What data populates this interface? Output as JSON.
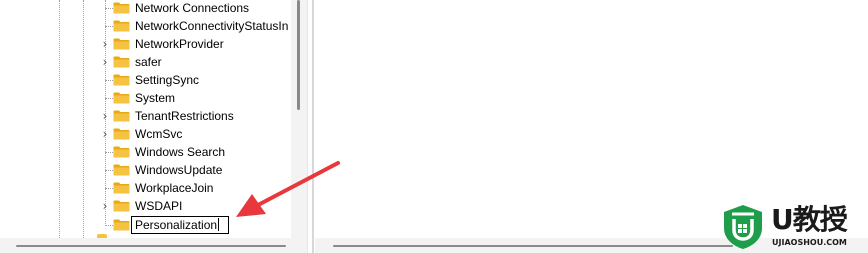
{
  "tree": {
    "items": [
      {
        "label": "Network Connections",
        "expandable": false
      },
      {
        "label": "NetworkConnectivityStatusIn",
        "expandable": false
      },
      {
        "label": "NetworkProvider",
        "expandable": true
      },
      {
        "label": "safer",
        "expandable": true
      },
      {
        "label": "SettingSync",
        "expandable": false
      },
      {
        "label": "System",
        "expandable": false
      },
      {
        "label": "TenantRestrictions",
        "expandable": true
      },
      {
        "label": "WcmSvc",
        "expandable": true
      },
      {
        "label": "Windows Search",
        "expandable": false
      },
      {
        "label": "WindowsUpdate",
        "expandable": false
      },
      {
        "label": "WorkplaceJoin",
        "expandable": false
      },
      {
        "label": "WSDAPI",
        "expandable": true
      }
    ],
    "new_key": {
      "value": "Personalization",
      "editing": true
    }
  },
  "icons": {
    "folder": "folder-icon",
    "expand": "chevron-right-icon"
  },
  "colors": {
    "folder_fill": "#F5C242",
    "folder_tab": "#E8A917",
    "annotation_arrow": "#E8383D",
    "logo_green": "#1E9E4A"
  },
  "watermark": {
    "title": "U教授",
    "url": "UJIAOSHOU.COM"
  }
}
